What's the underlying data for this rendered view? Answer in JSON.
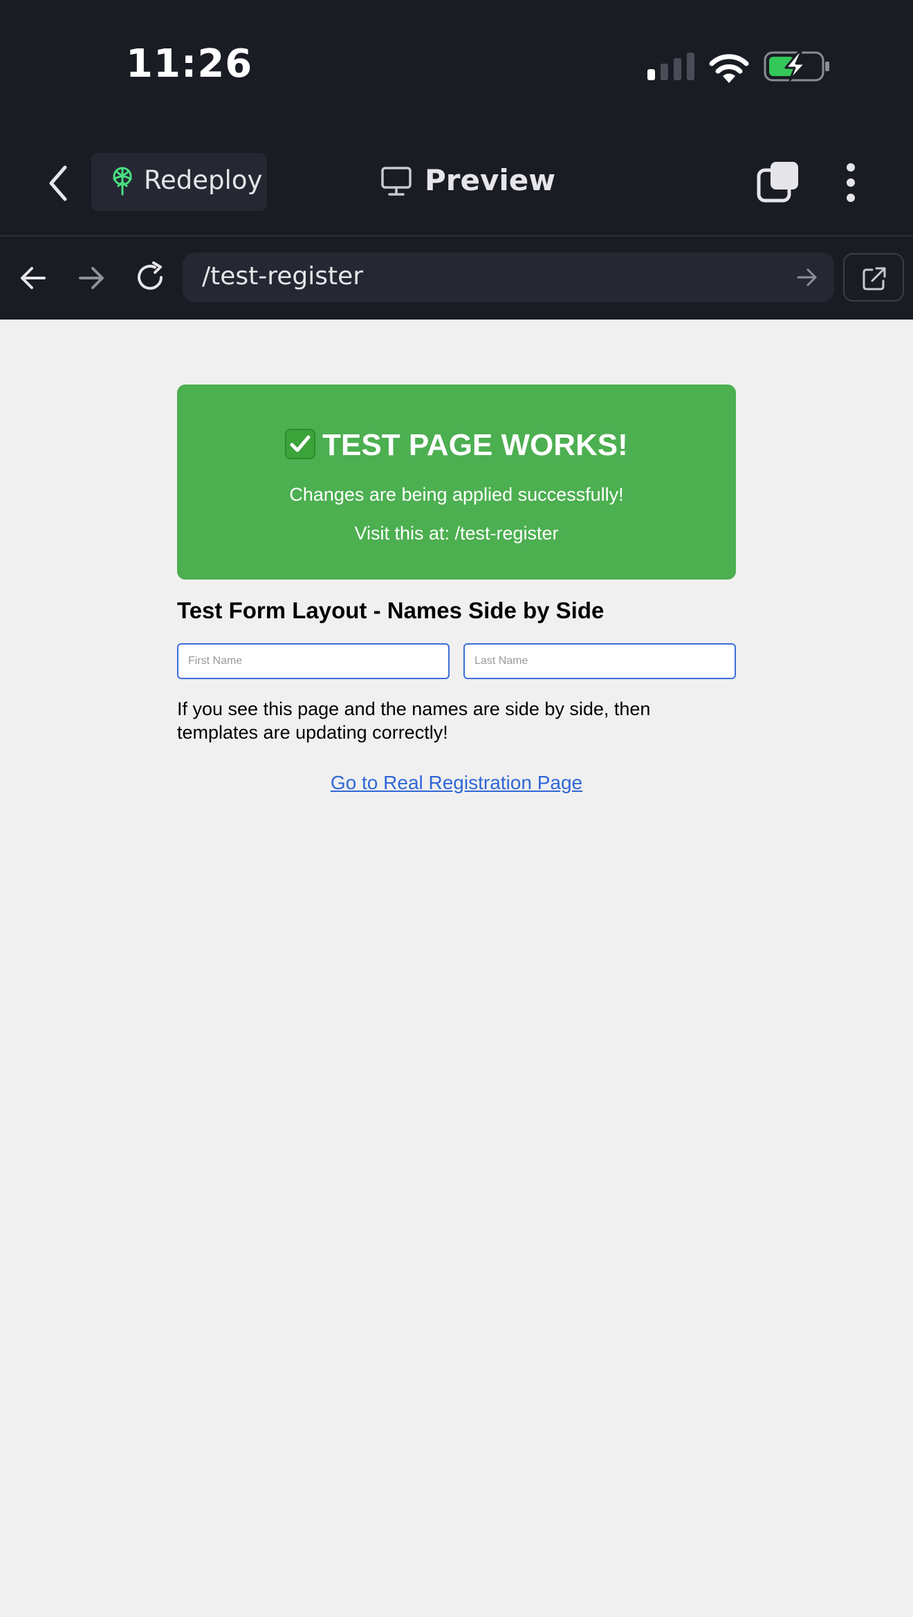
{
  "status_bar": {
    "time": "11:26",
    "signal_icon": "cellular-signal-icon",
    "wifi_icon": "wifi-icon",
    "battery_icon": "battery-charging-icon",
    "battery_color": "#34c759"
  },
  "app_header": {
    "back_icon": "chevron-left-icon",
    "redeploy_label": "Redeploy",
    "redeploy_icon": "redeploy-icon",
    "redeploy_icon_color": "#4ade80",
    "preview_label": "Preview",
    "preview_icon": "monitor-icon",
    "tabs_icon": "tabs-icon",
    "more_icon": "more-vertical-icon"
  },
  "browser_bar": {
    "back_icon": "arrow-left-icon",
    "forward_icon": "arrow-right-icon",
    "reload_icon": "reload-icon",
    "url": "/test-register",
    "go_icon": "arrow-right-icon",
    "external_icon": "external-link-icon"
  },
  "banner": {
    "icon": "check-mark-icon",
    "title": "TEST PAGE WORKS!",
    "line1": "Changes are being applied successfully!",
    "line2": "Visit this at: /test-register",
    "background": "#4caf50"
  },
  "form": {
    "heading": "Test Form Layout - Names Side by Side",
    "first_name_placeholder": "First Name",
    "last_name_placeholder": "Last Name",
    "first_name_value": "",
    "last_name_value": ""
  },
  "info_text": "If you see this page and the names are side by side, then templates are updating correctly!",
  "link_text": "Go to Real Registration Page",
  "colors": {
    "chrome_background": "#1a1c24",
    "page_background": "#f0f0f0",
    "link": "#2f67d6",
    "input_border": "#3a6fd8"
  }
}
